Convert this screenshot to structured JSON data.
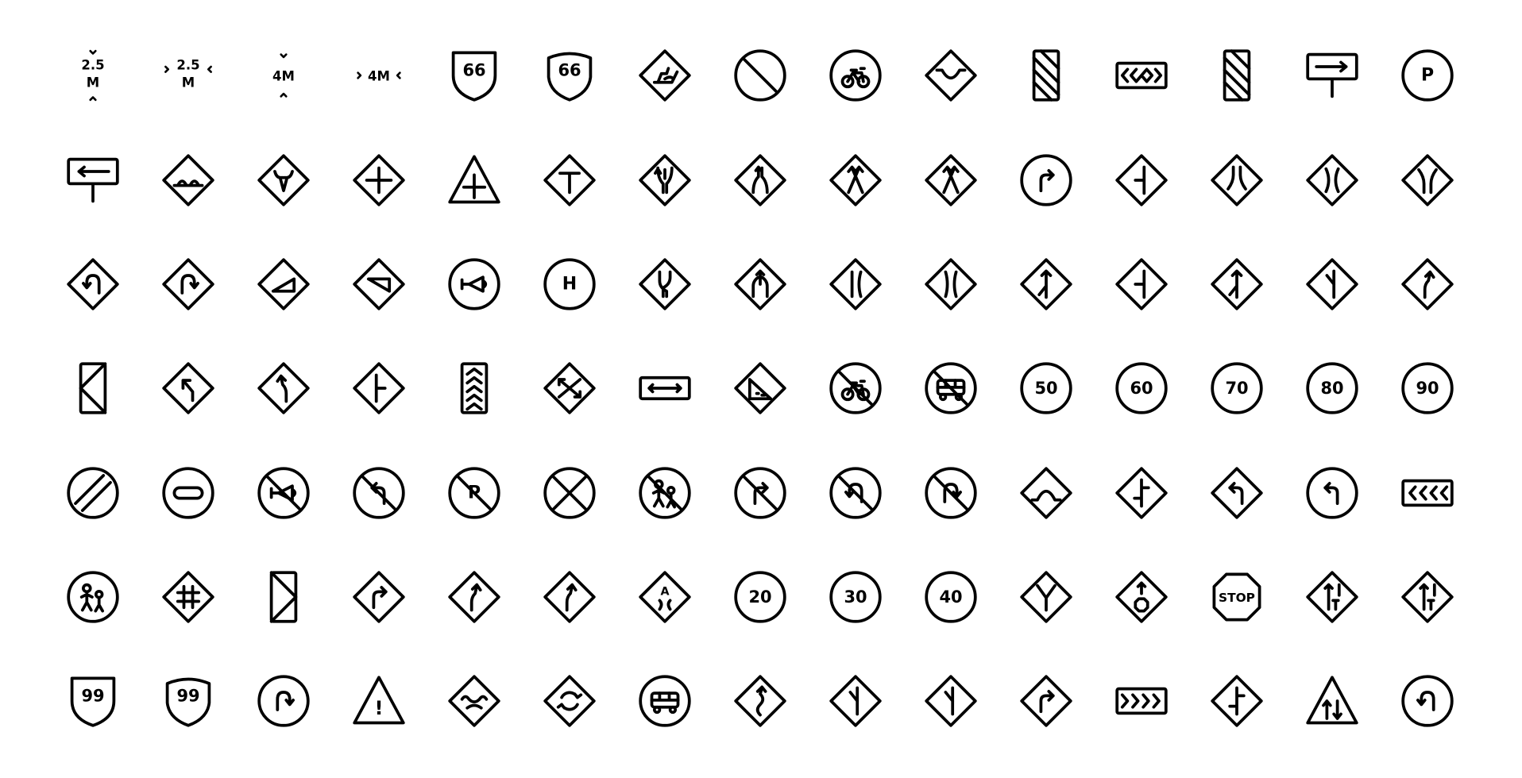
{
  "colors": {
    "stroke": "#000000",
    "background": "#ffffff"
  },
  "icons": [
    [
      {
        "name": "max-height-2.5m-icon",
        "frame": "none",
        "glyph": "vmark",
        "text": "2.5",
        "text2": "M"
      },
      {
        "name": "max-width-2.5m-icon",
        "frame": "none",
        "glyph": "hmark",
        "text": "2.5",
        "text2": "M"
      },
      {
        "name": "max-height-4m-icon",
        "frame": "none",
        "glyph": "vmark",
        "text": "4M"
      },
      {
        "name": "max-width-4m-icon",
        "frame": "none",
        "glyph": "hmark",
        "text": "4M"
      },
      {
        "name": "route-66-shield-icon",
        "frame": "shield",
        "glyph": "text",
        "text": "66"
      },
      {
        "name": "route-66-rounded-shield-icon",
        "frame": "shield-round",
        "glyph": "text",
        "text": "66"
      },
      {
        "name": "slippery-road-icon",
        "frame": "diamond",
        "glyph": "skid"
      },
      {
        "name": "no-entry-icon",
        "frame": "circle",
        "glyph": "slash"
      },
      {
        "name": "bicycle-icon",
        "frame": "circle",
        "glyph": "bike"
      },
      {
        "name": "dip-road-icon",
        "frame": "diamond",
        "glyph": "dip"
      },
      {
        "name": "hazard-marker-icon",
        "frame": "rect-v",
        "glyph": "stripes"
      },
      {
        "name": "chevron-marker-icon",
        "frame": "rect-h",
        "glyph": "chevrons-both"
      },
      {
        "name": "hazard-marker-right-icon",
        "frame": "rect-v",
        "glyph": "stripes"
      },
      {
        "name": "direction-right-sign-icon",
        "frame": "post",
        "glyph": "arrow-right"
      },
      {
        "name": "parking-icon",
        "frame": "circle",
        "glyph": "text",
        "text": "P"
      }
    ],
    [
      {
        "name": "direction-left-sign-icon",
        "frame": "post",
        "glyph": "arrow-left"
      },
      {
        "name": "speed-bump-icon",
        "frame": "diamond",
        "glyph": "bumps"
      },
      {
        "name": "cattle-crossing-icon",
        "frame": "diamond",
        "glyph": "cattle"
      },
      {
        "name": "crossroad-icon",
        "frame": "diamond",
        "glyph": "cross"
      },
      {
        "name": "crossroad-triangle-icon",
        "frame": "triangle",
        "glyph": "cross-low"
      },
      {
        "name": "t-junction-icon",
        "frame": "diamond",
        "glyph": "t"
      },
      {
        "name": "merge-lanes-icon",
        "frame": "diamond",
        "glyph": "arrows-in"
      },
      {
        "name": "diverge-lanes-icon",
        "frame": "diamond",
        "glyph": "arrows-out"
      },
      {
        "name": "lane-shift-left-icon",
        "frame": "diamond",
        "glyph": "arrows-cross"
      },
      {
        "name": "lane-shift-right-icon",
        "frame": "diamond",
        "glyph": "arrows-cross"
      },
      {
        "name": "turn-right-icon",
        "frame": "circle",
        "glyph": "turn-right"
      },
      {
        "name": "side-road-left-icon",
        "frame": "diamond",
        "glyph": "side-left"
      },
      {
        "name": "road-narrows-icon",
        "frame": "diamond",
        "glyph": "narrow-top"
      },
      {
        "name": "narrow-bridge-icon",
        "frame": "diamond",
        "glyph": "narrow"
      },
      {
        "name": "road-widens-icon",
        "frame": "diamond",
        "glyph": "narrow-bottom"
      }
    ],
    [
      {
        "name": "u-turn-left-icon",
        "frame": "diamond",
        "glyph": "uturn-left"
      },
      {
        "name": "u-turn-right-icon",
        "frame": "diamond",
        "glyph": "uturn-right"
      },
      {
        "name": "steep-ascent-icon",
        "frame": "diamond",
        "glyph": "wedge-up"
      },
      {
        "name": "steep-descent-icon",
        "frame": "diamond",
        "glyph": "wedge-down"
      },
      {
        "name": "horn-icon",
        "frame": "circle",
        "glyph": "horn"
      },
      {
        "name": "hospital-icon",
        "frame": "circle",
        "glyph": "text",
        "text": "H"
      },
      {
        "name": "lane-curve-icon",
        "frame": "diamond",
        "glyph": "lanes-curve"
      },
      {
        "name": "lane-merge-icon",
        "frame": "diamond",
        "glyph": "lanes-merge"
      },
      {
        "name": "lane-narrows-left-icon",
        "frame": "diamond",
        "glyph": "lanes-a"
      },
      {
        "name": "lane-narrows-right-icon",
        "frame": "diamond",
        "glyph": "lanes-b"
      },
      {
        "name": "side-road-merge-icon",
        "frame": "diamond",
        "glyph": "branch-up"
      },
      {
        "name": "side-road-left-2-icon",
        "frame": "diamond",
        "glyph": "side-left"
      },
      {
        "name": "branch-right-icon",
        "frame": "diamond",
        "glyph": "branch-up"
      },
      {
        "name": "branch-left-icon",
        "frame": "diamond",
        "glyph": "branch-down"
      },
      {
        "name": "bend-right-icon",
        "frame": "diamond",
        "glyph": "curve"
      }
    ],
    [
      {
        "name": "left-direction-board-icon",
        "frame": "rect-v",
        "glyph": "tri-left"
      },
      {
        "name": "keep-left-icon",
        "frame": "diamond",
        "glyph": "arrow-upleft"
      },
      {
        "name": "curve-left-icon",
        "frame": "diamond",
        "glyph": "curve-left"
      },
      {
        "name": "side-road-right-icon",
        "frame": "diamond",
        "glyph": "side-right"
      },
      {
        "name": "chevron-up-marker-icon",
        "frame": "rect-v",
        "glyph": "chevrons-up"
      },
      {
        "name": "two-way-split-icon",
        "frame": "diamond",
        "glyph": "arrows-split"
      },
      {
        "name": "width-indicator-icon",
        "frame": "rect-h-thin",
        "glyph": "double-arrow-h"
      },
      {
        "name": "falling-rocks-icon",
        "frame": "diamond",
        "glyph": "rocks"
      },
      {
        "name": "no-bicycle-icon",
        "frame": "circle",
        "glyph": "bike",
        "prohibited": true
      },
      {
        "name": "no-bus-icon",
        "frame": "circle",
        "glyph": "bus",
        "prohibited": true
      },
      {
        "name": "speed-limit-50-icon",
        "frame": "circle",
        "glyph": "text",
        "text": "50"
      },
      {
        "name": "speed-limit-60-icon",
        "frame": "circle",
        "glyph": "text",
        "text": "60"
      },
      {
        "name": "speed-limit-70-icon",
        "frame": "circle",
        "glyph": "text",
        "text": "70"
      },
      {
        "name": "speed-limit-80-icon",
        "frame": "circle",
        "glyph": "text",
        "text": "80"
      },
      {
        "name": "speed-limit-90-icon",
        "frame": "circle",
        "glyph": "text",
        "text": "90"
      }
    ],
    [
      {
        "name": "end-restriction-icon",
        "frame": "circle",
        "glyph": "end"
      },
      {
        "name": "no-entry-bar-icon",
        "frame": "circle",
        "glyph": "bar"
      },
      {
        "name": "no-horn-icon",
        "frame": "circle",
        "glyph": "horn",
        "prohibited": true
      },
      {
        "name": "no-left-turn-icon",
        "frame": "circle",
        "glyph": "turn-left",
        "prohibited": true
      },
      {
        "name": "no-parking-icon",
        "frame": "circle",
        "glyph": "text",
        "text": "P",
        "prohibited": true
      },
      {
        "name": "no-stopping-icon",
        "frame": "circle",
        "glyph": "x"
      },
      {
        "name": "no-pedestrians-icon",
        "frame": "circle",
        "glyph": "people",
        "prohibited": true
      },
      {
        "name": "no-right-turn-icon",
        "frame": "circle",
        "glyph": "turn-right",
        "prohibited": true
      },
      {
        "name": "no-u-turn-left-icon",
        "frame": "circle",
        "glyph": "uturn-left",
        "prohibited": true
      },
      {
        "name": "no-u-turn-right-icon",
        "frame": "circle",
        "glyph": "uturn-right",
        "prohibited": true
      },
      {
        "name": "hump-icon",
        "frame": "diamond",
        "glyph": "hump"
      },
      {
        "name": "staggered-junction-icon",
        "frame": "diamond",
        "glyph": "stagger"
      },
      {
        "name": "turn-left-warning-icon",
        "frame": "diamond",
        "glyph": "turn-left"
      },
      {
        "name": "turn-left-mandatory-icon",
        "frame": "circle",
        "glyph": "turn-left"
      },
      {
        "name": "chevron-left-marker-icon",
        "frame": "rect-h",
        "glyph": "chevrons-left"
      }
    ],
    [
      {
        "name": "pedestrians-icon",
        "frame": "circle",
        "glyph": "people"
      },
      {
        "name": "railroad-crossing-icon",
        "frame": "diamond",
        "glyph": "hash"
      },
      {
        "name": "right-direction-board-icon",
        "frame": "rect-v",
        "glyph": "tri-right"
      },
      {
        "name": "turn-right-warning-icon",
        "frame": "diamond",
        "glyph": "turn-right"
      },
      {
        "name": "curve-right-icon",
        "frame": "diamond",
        "glyph": "curve"
      },
      {
        "name": "bend-right-2-icon",
        "frame": "diamond",
        "glyph": "curve"
      },
      {
        "name": "school-zone-icon",
        "frame": "diamond",
        "glyph": "school",
        "text": "A"
      },
      {
        "name": "speed-limit-20-icon",
        "frame": "circle",
        "glyph": "text",
        "text": "20"
      },
      {
        "name": "speed-limit-30-icon",
        "frame": "circle",
        "glyph": "text",
        "text": "30"
      },
      {
        "name": "speed-limit-40-icon",
        "frame": "circle",
        "glyph": "text",
        "text": "40"
      },
      {
        "name": "y-junction-icon",
        "frame": "diamond",
        "glyph": "y"
      },
      {
        "name": "stop-ahead-icon",
        "frame": "diamond",
        "glyph": "stop-ahead"
      },
      {
        "name": "stop-sign-icon",
        "frame": "octagon",
        "glyph": "text-small",
        "text": "STOP"
      },
      {
        "name": "t-intersection-arrow-left-icon",
        "frame": "diamond",
        "glyph": "arrow-t"
      },
      {
        "name": "t-intersection-arrow-right-icon",
        "frame": "diamond",
        "glyph": "arrow-t"
      }
    ],
    [
      {
        "name": "route-99-shield-icon",
        "frame": "shield",
        "glyph": "text",
        "text": "99"
      },
      {
        "name": "route-99-rounded-shield-icon",
        "frame": "shield-round",
        "glyph": "text",
        "text": "99"
      },
      {
        "name": "turn-right-circle-icon",
        "frame": "circle",
        "glyph": "uturn-right"
      },
      {
        "name": "warning-icon",
        "frame": "triangle",
        "glyph": "text-low",
        "text": "!"
      },
      {
        "name": "uneven-road-icon",
        "frame": "diamond",
        "glyph": "uneven"
      },
      {
        "name": "roundabout-icon",
        "frame": "diamond",
        "glyph": "roundabout"
      },
      {
        "name": "bus-icon",
        "frame": "circle",
        "glyph": "bus"
      },
      {
        "name": "winding-road-icon",
        "frame": "diamond",
        "glyph": "winding"
      },
      {
        "name": "side-road-left-3-icon",
        "frame": "diamond",
        "glyph": "branch-down"
      },
      {
        "name": "side-road-right-2-icon",
        "frame": "diamond",
        "glyph": "branch-down"
      },
      {
        "name": "turn-right-ahead-icon",
        "frame": "diamond",
        "glyph": "turn-right"
      },
      {
        "name": "chevron-right-marker-icon",
        "frame": "rect-h",
        "glyph": "chevrons-right"
      },
      {
        "name": "staggered-junction-2-icon",
        "frame": "diamond",
        "glyph": "stagger"
      },
      {
        "name": "two-way-traffic-icon",
        "frame": "triangle",
        "glyph": "two-way"
      },
      {
        "name": "u-turn-circle-icon",
        "frame": "circle",
        "glyph": "uturn-left"
      }
    ]
  ]
}
